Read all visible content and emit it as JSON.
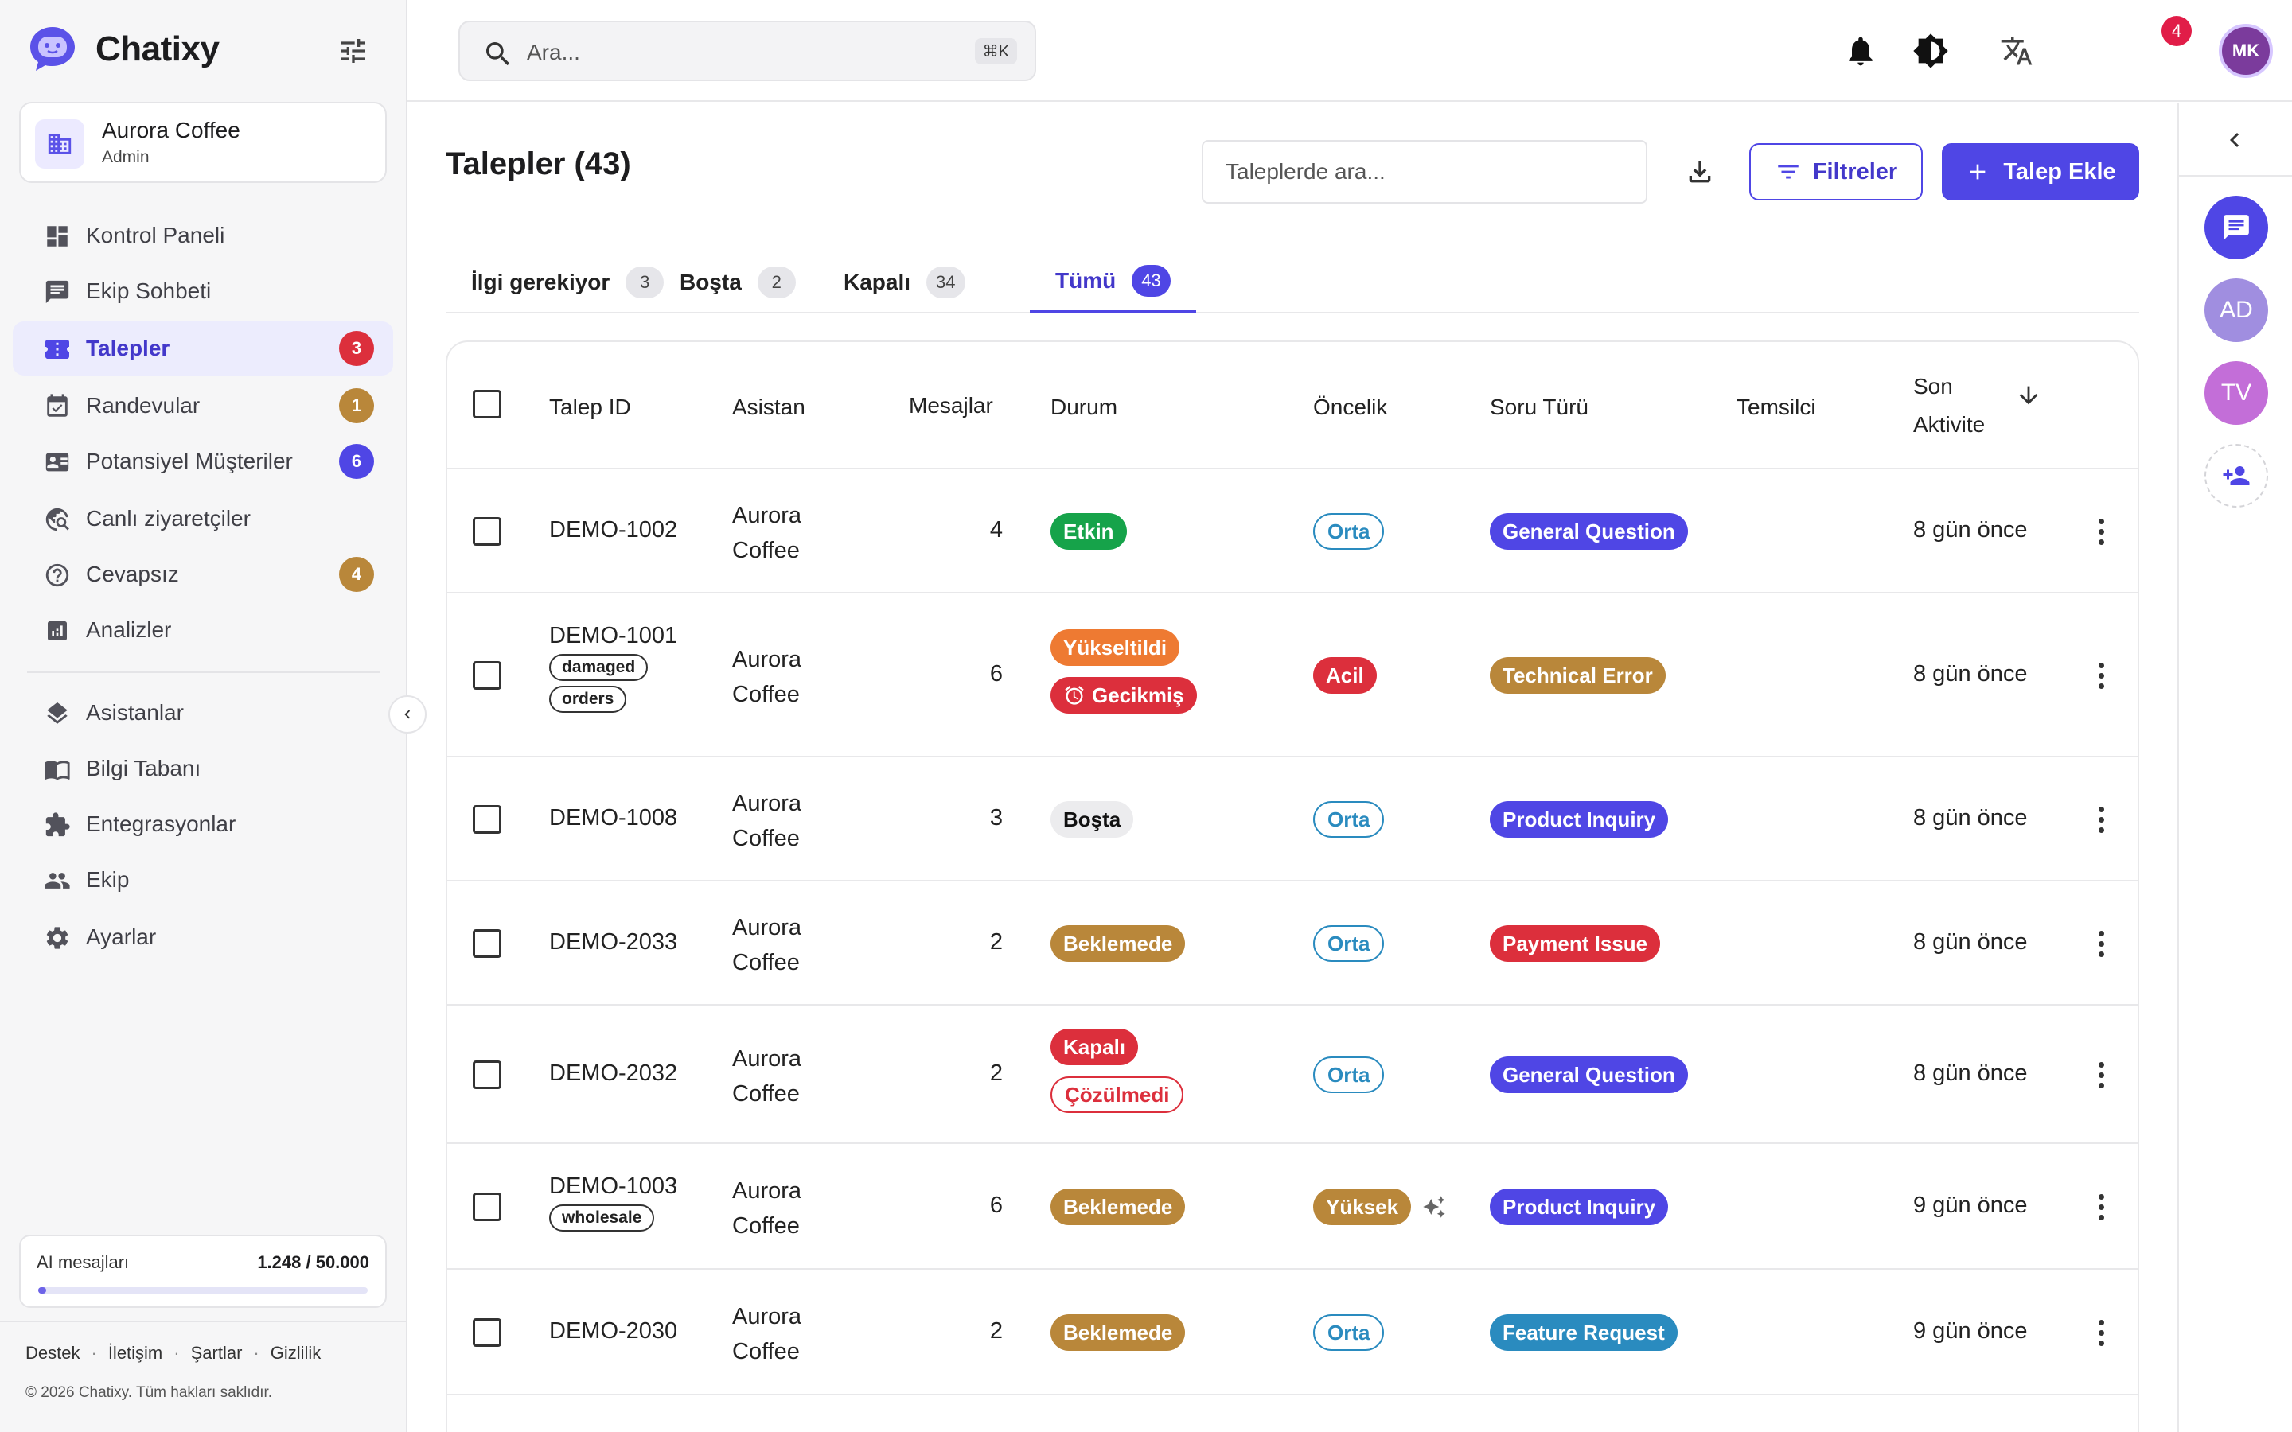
{
  "brand": {
    "name": "Chatixy"
  },
  "workspace": {
    "name": "Aurora Coffee",
    "role": "Admin"
  },
  "nav": {
    "dashboard": "Kontrol Paneli",
    "team_chat": "Ekip Sohbeti",
    "tickets": "Talepler",
    "tickets_badge": "3",
    "appointments": "Randevular",
    "appointments_badge": "1",
    "leads": "Potansiyel Müşteriler",
    "leads_badge": "6",
    "live_visitors": "Canlı ziyaretçiler",
    "unanswered": "Cevapsız",
    "unanswered_badge": "4",
    "analytics": "Analizler",
    "assistants": "Asistanlar",
    "knowledge": "Bilgi Tabanı",
    "integrations": "Entegrasyonlar",
    "team": "Ekip",
    "settings": "Ayarlar"
  },
  "usage": {
    "label": "AI mesajları",
    "value": "1.248 / 50.000",
    "fraction": 0.025
  },
  "footer": {
    "support": "Destek",
    "contact": "İletişim",
    "terms": "Şartlar",
    "privacy": "Gizlilik",
    "copyright": "© 2026 Chatixy. Tüm hakları saklıdır."
  },
  "topbar": {
    "search_placeholder": "Ara...",
    "shortcut": "⌘K",
    "notification_count": "4",
    "user_initials": "MK"
  },
  "page": {
    "title": "Talepler (43)",
    "search_placeholder": "Taleplerde ara...",
    "filters": "Filtreler",
    "add": "Talep Ekle"
  },
  "tabs": [
    {
      "label": "İlgi gerekiyor",
      "count": "3"
    },
    {
      "label": "Boşta",
      "count": "2"
    },
    {
      "label": "Kapalı",
      "count": "34"
    },
    {
      "label": "Tümü",
      "count": "43"
    }
  ],
  "columns": {
    "id": "Talep ID",
    "assistant": "Asistan",
    "messages": "Mesajlar",
    "status": "Durum",
    "priority": "Öncelik",
    "type": "Soru Türü",
    "agent": "Temsilci",
    "last1": "Son",
    "last2": "Aktivite"
  },
  "rows": [
    {
      "id": "DEMO-1002",
      "a1": "Aurora",
      "a2": "Coffee",
      "msgs": "4",
      "status": "Etkin",
      "priority": "Orta",
      "type": "General Question",
      "last": "8 gün önce"
    },
    {
      "id": "DEMO-1001",
      "tag1": "damaged",
      "tag2": "orders",
      "a1": "Aurora",
      "a2": "Coffee",
      "msgs": "6",
      "status": "Yükseltildi",
      "status2": "Gecikmiş",
      "priority": "Acil",
      "type": "Technical Error",
      "last": "8 gün önce"
    },
    {
      "id": "DEMO-1008",
      "a1": "Aurora",
      "a2": "Coffee",
      "msgs": "3",
      "status": "Boşta",
      "priority": "Orta",
      "type": "Product Inquiry",
      "last": "8 gün önce"
    },
    {
      "id": "DEMO-2033",
      "a1": "Aurora",
      "a2": "Coffee",
      "msgs": "2",
      "status": "Beklemede",
      "priority": "Orta",
      "type": "Payment Issue",
      "last": "8 gün önce"
    },
    {
      "id": "DEMO-2032",
      "a1": "Aurora",
      "a2": "Coffee",
      "msgs": "2",
      "status": "Kapalı",
      "status2": "Çözülmedi",
      "priority": "Orta",
      "type": "General Question",
      "last": "8 gün önce"
    },
    {
      "id": "DEMO-1003",
      "tag1": "wholesale",
      "a1": "Aurora",
      "a2": "Coffee",
      "msgs": "6",
      "status": "Beklemede",
      "priority": "Yüksek",
      "type": "Product Inquiry",
      "last": "9 gün önce"
    },
    {
      "id": "DEMO-2030",
      "a1": "Aurora",
      "a2": "Coffee",
      "msgs": "2",
      "status": "Beklemede",
      "priority": "Orta",
      "type": "Feature Request",
      "last": "9 gün önce"
    }
  ],
  "rail": {
    "avatar1": "AD",
    "avatar2": "TV"
  },
  "colors": {
    "accent": "#4f46e5",
    "green": "#16a34a",
    "orange": "#ee7a32",
    "red": "#dc2f3c",
    "gold": "#b9873a",
    "blue": "#2a8bbf"
  }
}
